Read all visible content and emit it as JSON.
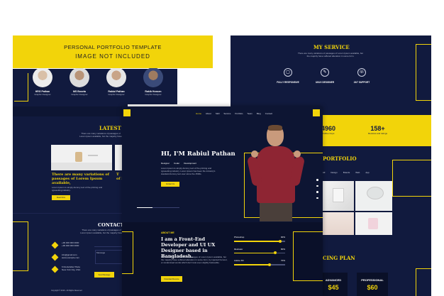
{
  "banner": {
    "line1": "PERSONAL PORTFOLIO TEMPLATE",
    "line2": "IMAGE NOT INCLUDED"
  },
  "team": [
    {
      "name": "HRG Pathan",
      "role": "Graphic Designer"
    },
    {
      "name": "MS Boseta",
      "role": "Graphic Designer"
    },
    {
      "name": "Rabiul Pathan",
      "role": "Graphic Designer"
    },
    {
      "name": "Rakib Hossen",
      "role": "Graphic Designer"
    }
  ],
  "left": {
    "latest_title": "LATEST BL",
    "latest_sub": "There are many variations of passages of Lorem Ipsum available, but the majority have suffered alteration in some form.",
    "blog_heading": "There are many variations of passages of Lorem Ipsum available,",
    "blog_heading2": "T\nof L",
    "blog_text": "Lorem Ipsum is simply dummy text of the printing and typesetting industry.",
    "read_more": "Read More",
    "contact_title": "CONTACT U",
    "contact_sub": "There are many variations of passages of Lorem Ipsum available, but the majority have suffered alteration.",
    "contact_items": [
      "+99 000 000 0000\n+99 000 000 0000",
      "info@gmail.com\nwww.example.com",
      "6 Rockefeller Plaza\nNew York City, USA"
    ],
    "message_label": "Message",
    "send_button": "Send Message",
    "copyright": "Copyright © 2019 - All Rights Reserved"
  },
  "right": {
    "service_title": "MY SERVICE",
    "service_sub": "There are many variations of passages of Lorem Ipsum available, but the majority have suffered alteration in some form.",
    "services": [
      "FULLY RESPONSIVE",
      "UI/UX DESIGNER",
      "24/7 SUPPORT"
    ],
    "stats": [
      {
        "value": "4960",
        "label": "Coffee Cups"
      },
      {
        "value": "158+",
        "label": "Reviews and ratings"
      }
    ],
    "portfolio_title": "PORTFOLIO",
    "portfolio_filters": [
      "All",
      "Design",
      "Brands",
      "Web",
      "App"
    ],
    "pricing_title": "CING PLAN",
    "plans": [
      {
        "name": "ADVANCED",
        "price": "$45"
      },
      {
        "name": "PROFESSIONAL",
        "price": "$60"
      }
    ]
  },
  "center": {
    "nav": [
      "Home",
      "About",
      "Skill",
      "Service",
      "Portfolio",
      "Team",
      "Blog",
      "Contact"
    ],
    "hero_title": "HI, I'M Rabiul Pathan",
    "roles": [
      "Designer",
      "Coder",
      "Development"
    ],
    "hero_text": "Lorem Ipsum is simply dummy text of the printing and typesetting industry. Lorem Ipsum has been the industry's standard dummy text ever since the 1500s.",
    "hero_button": "Contact Us",
    "about_label": "ABOUT ME",
    "about_title": "I am a Front-End Developer and UI UX Designer based in Bangladesh.",
    "about_text": "There are many variations of passages of Lorem Ipsum available, but the majority have suffered alteration in some form, by injected humour, or randomised words which don't look even slightly believable.",
    "download_button": "Download Resume",
    "skills": [
      {
        "name": "Photoshop",
        "pct": "90%",
        "value": 90
      },
      {
        "name": "Illustrator",
        "pct": "80%",
        "value": 80
      },
      {
        "name": "Adobe XD",
        "pct": "70%",
        "value": 70
      }
    ]
  }
}
